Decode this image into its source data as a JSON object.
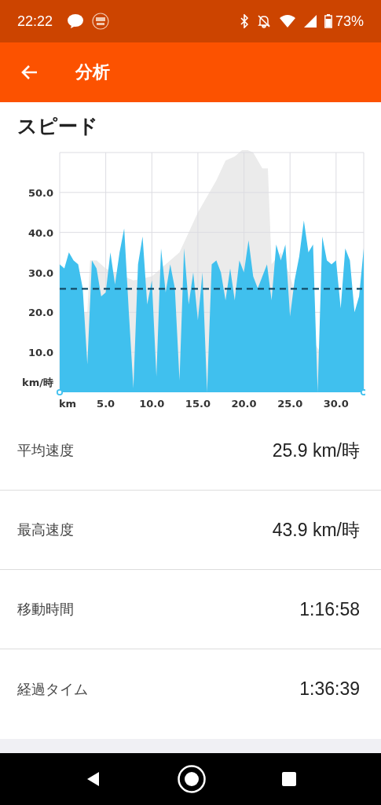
{
  "status_bar": {
    "time": "22:22",
    "battery_text": "73%"
  },
  "app_bar": {
    "title": "分析"
  },
  "section": {
    "title": "スピード"
  },
  "chart_data": {
    "type": "area",
    "ylabel": "km/時",
    "xlim": [
      0,
      33
    ],
    "ylim": [
      0,
      60
    ],
    "xticks": [
      {
        "value": 0,
        "label": "km"
      },
      {
        "value": 5,
        "label": "5.0"
      },
      {
        "value": 10,
        "label": "10.0"
      },
      {
        "value": 15,
        "label": "15.0"
      },
      {
        "value": 20,
        "label": "20.0"
      },
      {
        "value": 25,
        "label": "25.0"
      },
      {
        "value": 30,
        "label": "30.0"
      }
    ],
    "yticks": [
      {
        "value": 10,
        "label": "10.0"
      },
      {
        "value": 20,
        "label": "20.0"
      },
      {
        "value": 30,
        "label": "30.0"
      },
      {
        "value": 40,
        "label": "40.0"
      },
      {
        "value": 50,
        "label": "50.0"
      }
    ],
    "x": [
      0,
      0.5,
      1,
      1.5,
      2,
      2.5,
      3,
      3.5,
      4,
      4.5,
      5,
      5.5,
      6,
      6.5,
      7,
      7.5,
      8,
      8.5,
      9,
      9.5,
      10,
      10.5,
      11,
      11.5,
      12,
      12.5,
      13,
      13.5,
      14,
      14.5,
      15,
      15.5,
      16,
      16.5,
      17,
      17.5,
      18,
      18.5,
      19,
      19.5,
      20,
      20.5,
      21,
      21.5,
      22,
      22.5,
      23,
      23.5,
      24,
      24.5,
      25,
      25.5,
      26,
      26.5,
      27,
      27.5,
      28,
      28.5,
      29,
      29.5,
      30,
      30.5,
      31,
      31.5,
      32,
      32.5,
      33
    ],
    "grid": true,
    "series": [
      {
        "color": "#40c0ee",
        "values": [
          32,
          31,
          35,
          33,
          32,
          26,
          7,
          33,
          31,
          24,
          25,
          35,
          27,
          35,
          41,
          20,
          1,
          32,
          39,
          22,
          28,
          4,
          36,
          25,
          32,
          26,
          3,
          36,
          22,
          30,
          18,
          30,
          0,
          32,
          33,
          30,
          23,
          31,
          23,
          33,
          30,
          38,
          29,
          26,
          29,
          32,
          23,
          37,
          33,
          37,
          19,
          28,
          34,
          43,
          35,
          37,
          0,
          39,
          33,
          32,
          33,
          21,
          36,
          33,
          20,
          24,
          36
        ]
      }
    ],
    "ref_lines": [
      {
        "axis": "y",
        "value": 25.9
      }
    ]
  },
  "stats": [
    {
      "label": "平均速度",
      "value": "25.9 km/時"
    },
    {
      "label": "最高速度",
      "value": "43.9 km/時"
    },
    {
      "label": "移動時間",
      "value": "1:16:58"
    },
    {
      "label": "経過タイム",
      "value": "1:36:39"
    }
  ]
}
